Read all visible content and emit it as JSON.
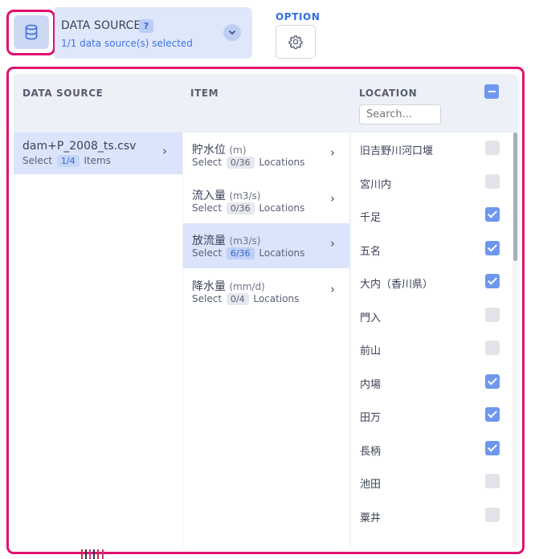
{
  "header": {
    "data_source_title": "DATA SOURCE",
    "help_badge": "?",
    "data_source_subtitle": "1/1 data source(s) selected",
    "option_label": "OPTION",
    "icons": {
      "database": "database-icon",
      "chevron": "chevron-down-icon",
      "option": "gear-icon"
    }
  },
  "columns": {
    "data_source": "DATA SOURCE",
    "item": "ITEM",
    "location": "LOCATION",
    "search_placeholder": "Search..."
  },
  "data_sources": [
    {
      "name": "dam+P_2008_ts.csv",
      "select_word": "Select",
      "count": "1/4",
      "unit_word": "Items"
    }
  ],
  "items": [
    {
      "name": "貯水位",
      "unit": "(m)",
      "select_word": "Select",
      "count": "0/36",
      "unit_word": "Locations",
      "active": false
    },
    {
      "name": "流入量",
      "unit": "(m3/s)",
      "select_word": "Select",
      "count": "0/36",
      "unit_word": "Locations",
      "active": false
    },
    {
      "name": "放流量",
      "unit": "(m3/s)",
      "select_word": "Select",
      "count": "6/36",
      "unit_word": "Locations",
      "active": true
    },
    {
      "name": "降水量",
      "unit": "(mm/d)",
      "select_word": "Select",
      "count": "0/4",
      "unit_word": "Locations",
      "active": false
    }
  ],
  "locations": [
    {
      "name": "旧吉野川河口堰",
      "checked": false
    },
    {
      "name": "宮川内",
      "checked": false
    },
    {
      "name": "千足",
      "checked": true
    },
    {
      "name": "五名",
      "checked": true
    },
    {
      "name": "大内（香川県）",
      "checked": true
    },
    {
      "name": "門入",
      "checked": false
    },
    {
      "name": "前山",
      "checked": false
    },
    {
      "name": "内場",
      "checked": true
    },
    {
      "name": "田万",
      "checked": true
    },
    {
      "name": "長柄",
      "checked": true
    },
    {
      "name": "池田",
      "checked": false
    },
    {
      "name": "粟井",
      "checked": false
    }
  ],
  "colors": {
    "accent": "#3f73e6",
    "highlight_ring": "#e2106f",
    "selected_row": "#dbe4fa",
    "checkbox_on": "#6f97ee"
  }
}
